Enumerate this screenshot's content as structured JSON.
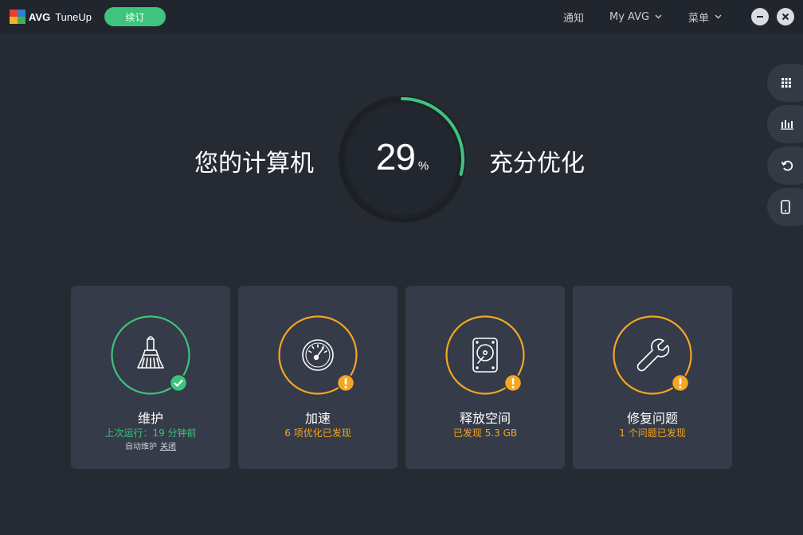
{
  "app": {
    "brand": "AVG",
    "product": "TuneUp",
    "renew_label": "续订"
  },
  "nav": {
    "notifications": "通知",
    "my_avg": "My AVG",
    "menu": "菜单"
  },
  "hero": {
    "left_text": "您的计算机",
    "percent_value": "29",
    "percent_unit": "%",
    "right_text": "充分优化",
    "progress": 0.29
  },
  "cards": [
    {
      "title": "维护",
      "status": "上次运行：19 分钟前",
      "extra_label": "自动维护",
      "extra_link": "关闭",
      "state": "ok",
      "icon": "broom-icon"
    },
    {
      "title": "加速",
      "status": "6 项优化已发现",
      "state": "warning",
      "icon": "speedometer-icon"
    },
    {
      "title": "释放空间",
      "status": "已发现 5.3 GB",
      "state": "warning",
      "icon": "hard-drive-icon"
    },
    {
      "title": "修复问题",
      "status": "1 个问题已发现",
      "state": "warning",
      "icon": "wrench-icon"
    }
  ],
  "side_rail": [
    "apps-grid-icon",
    "performance-chart-icon",
    "rescue-center-icon",
    "mobile-device-icon"
  ],
  "colors": {
    "background": "#252a33",
    "topbar": "#21252d",
    "card": "#353b48",
    "green": "#3ec47c",
    "orange": "#f5a623"
  }
}
